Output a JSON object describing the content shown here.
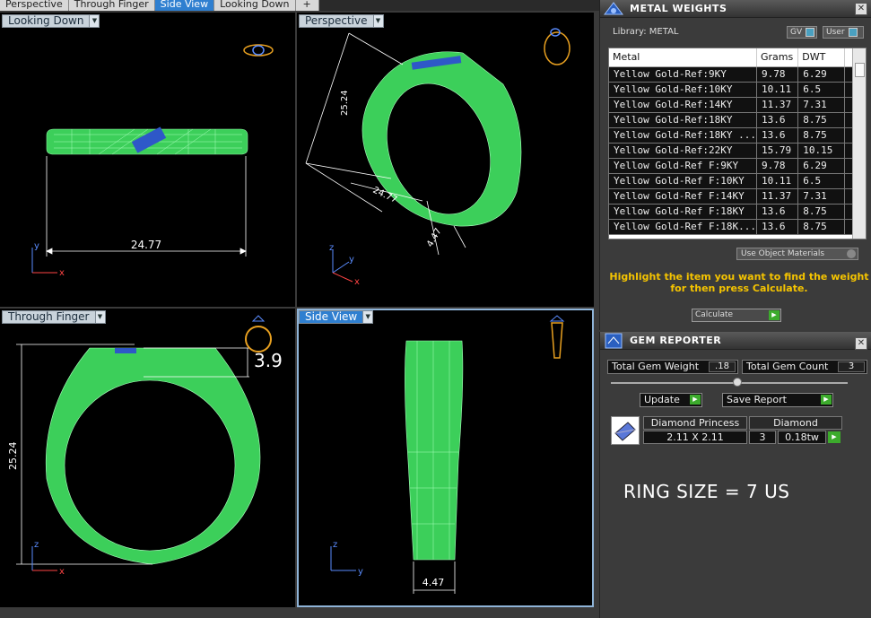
{
  "tabs": [
    {
      "label": "Perspective"
    },
    {
      "label": "Through Finger"
    },
    {
      "label": "Side View"
    },
    {
      "label": "Looking Down"
    },
    {
      "label": "+"
    }
  ],
  "viewports": {
    "looking_down": {
      "label": "Looking Down",
      "dimension": "24.77",
      "axis_v": "y",
      "axis_h": "x"
    },
    "perspective": {
      "label": "Perspective",
      "dimension_a": "25.24",
      "dimension_b": "24.77",
      "dimension_c": "4.47",
      "axis_v": "z",
      "axis_a": "y",
      "axis_b": "x"
    },
    "through_finger": {
      "label": "Through Finger",
      "dimension": "25.24",
      "callout": "3.9",
      "axis_v": "z",
      "axis_h": "x"
    },
    "side_view": {
      "label": "Side View",
      "dimension": "4.47",
      "axis_v": "z",
      "axis_h": "y"
    }
  },
  "metal_weights": {
    "title": "METAL WEIGHTS",
    "library_label": "Library: METAL",
    "toggle_gv": "GV",
    "toggle_user": "User",
    "columns": [
      "Metal",
      "Grams",
      "DWT"
    ],
    "rows": [
      [
        "Yellow Gold-Ref:9KY",
        "9.78",
        "6.29"
      ],
      [
        "Yellow Gold-Ref:10KY",
        "10.11",
        "6.5"
      ],
      [
        "Yellow Gold-Ref:14KY",
        "11.37",
        "7.31"
      ],
      [
        "Yellow Gold-Ref:18KY",
        "13.6",
        "8.75"
      ],
      [
        "Yellow Gold-Ref:18KY ...",
        "13.6",
        "8.75"
      ],
      [
        "Yellow Gold-Ref:22KY",
        "15.79",
        "10.15"
      ],
      [
        "Yellow Gold-Ref F:9KY",
        "9.78",
        "6.29"
      ],
      [
        "Yellow Gold-Ref F:10KY",
        "10.11",
        "6.5"
      ],
      [
        "Yellow Gold-Ref F:14KY",
        "11.37",
        "7.31"
      ],
      [
        "Yellow Gold-Ref F:18KY",
        "13.6",
        "8.75"
      ],
      [
        "Yellow Gold-Ref F:18K...",
        "13.6",
        "8.75"
      ]
    ],
    "use_object_materials": "Use Object Materials",
    "hint": "Highlight the item you want to find the weight for then press Calculate.",
    "calculate": "Calculate"
  },
  "gem_reporter": {
    "title": "GEM REPORTER",
    "total_weight_label": "Total Gem Weight",
    "total_weight_value": ".18",
    "total_count_label": "Total Gem Count",
    "total_count_value": "3",
    "update": "Update",
    "save_report": "Save Report",
    "gem": {
      "shape": "Diamond Princess",
      "type": "Diamond",
      "size": "2.11 X 2.11",
      "count": "3",
      "weight": "0.18tw"
    },
    "annotation": "RING SIZE = 7 US"
  },
  "colors": {
    "ring_green": "#3ccf5a",
    "stone_blue": "#2e58c8",
    "dim_white": "#ffffff",
    "accent_yellow": "#f5c400"
  }
}
